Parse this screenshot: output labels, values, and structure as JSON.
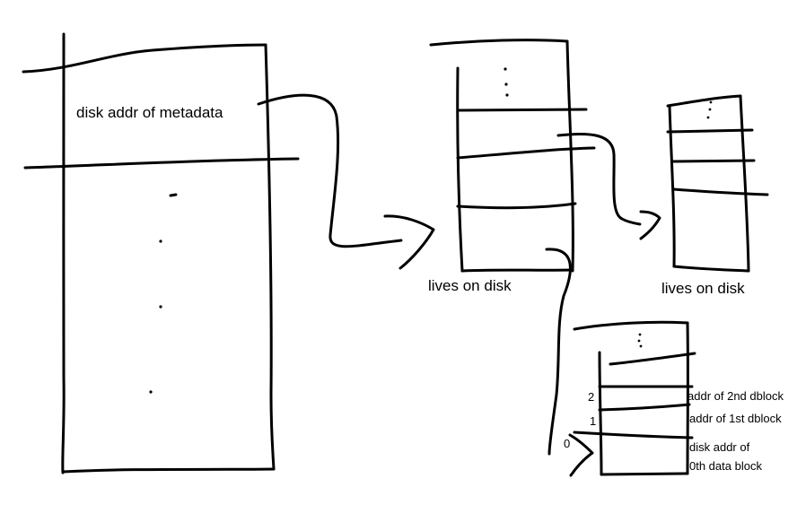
{
  "labels": {
    "metadata_pointer": "disk addr of metadata",
    "lives_on_disk_middle": "lives on disk",
    "lives_on_disk_right": "lives on disk",
    "addr_2nd": "addr of 2nd dblock",
    "addr_1st": "addr of 1st dblock",
    "disk_addr_of": "disk addr of",
    "data_block_0": "0th data block"
  },
  "slot_indices": [
    "2",
    "1",
    "0"
  ],
  "ellipsis": "⋮",
  "ink_color": "#000000"
}
